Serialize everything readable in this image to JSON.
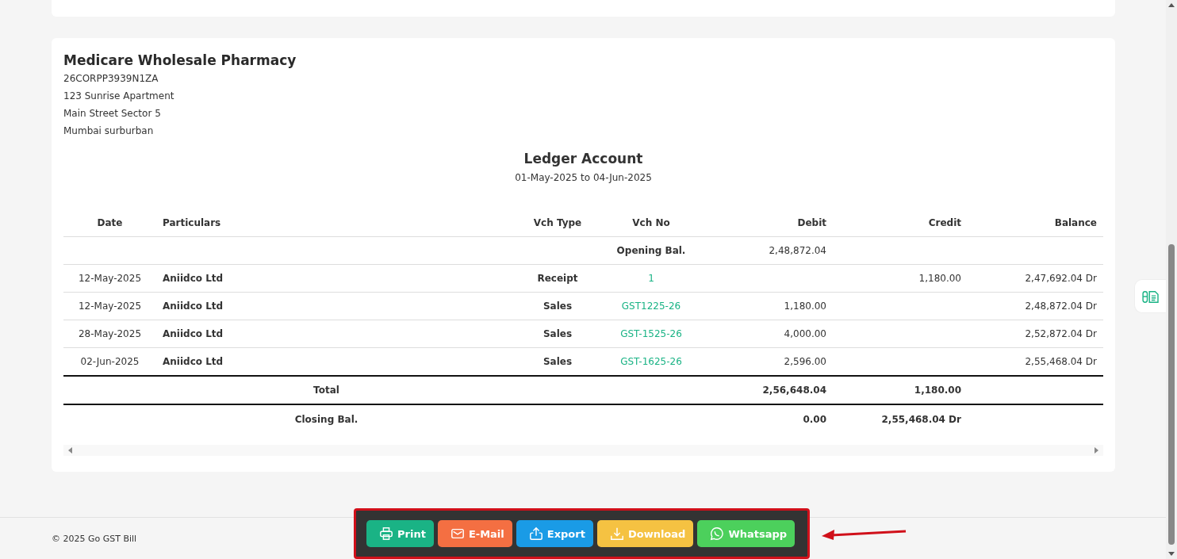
{
  "company": {
    "name": "Medicare Wholesale Pharmacy",
    "lines": [
      "26CORPP3939N1ZA",
      "123 Sunrise Apartment",
      "Main Street Sector 5",
      "Mumbai surburban"
    ]
  },
  "report": {
    "title": "Ledger Account",
    "period": "01-May-2025 to 04-Jun-2025"
  },
  "table": {
    "columns": [
      "Date",
      "Particulars",
      "Vch Type",
      "Vch No",
      "Debit",
      "Credit",
      "Balance"
    ],
    "opening": {
      "label": "Opening Bal.",
      "debit": "2,48,872.04"
    },
    "rows": [
      {
        "date": "12-May-2025",
        "particulars": "Aniidco Ltd",
        "vch_type": "Receipt",
        "vch_no": "1",
        "debit": "",
        "credit": "1,180.00",
        "balance": "2,47,692.04 Dr"
      },
      {
        "date": "12-May-2025",
        "particulars": "Aniidco Ltd",
        "vch_type": "Sales",
        "vch_no": "GST1225-26",
        "debit": "1,180.00",
        "credit": "",
        "balance": "2,48,872.04 Dr"
      },
      {
        "date": "28-May-2025",
        "particulars": "Aniidco Ltd",
        "vch_type": "Sales",
        "vch_no": "GST-1525-26",
        "debit": "4,000.00",
        "credit": "",
        "balance": "2,52,872.04 Dr"
      },
      {
        "date": "02-Jun-2025",
        "particulars": "Aniidco Ltd",
        "vch_type": "Sales",
        "vch_no": "GST-1625-26",
        "debit": "2,596.00",
        "credit": "",
        "balance": "2,55,468.04 Dr"
      }
    ],
    "total": {
      "label": "Total",
      "debit": "2,56,648.04",
      "credit": "1,180.00"
    },
    "closing": {
      "label": "Closing Bal.",
      "debit": "0.00",
      "credit": "2,55,468.04 Dr"
    }
  },
  "toolbar": [
    {
      "kind": "print",
      "label": "Print"
    },
    {
      "kind": "email",
      "label": "E-Mail"
    },
    {
      "kind": "export",
      "label": "Export"
    },
    {
      "kind": "download",
      "label": "Download"
    },
    {
      "kind": "whatsapp",
      "label": "Whatsapp"
    }
  ],
  "footer": {
    "copyright": "© 2025 Go GST Bill"
  }
}
